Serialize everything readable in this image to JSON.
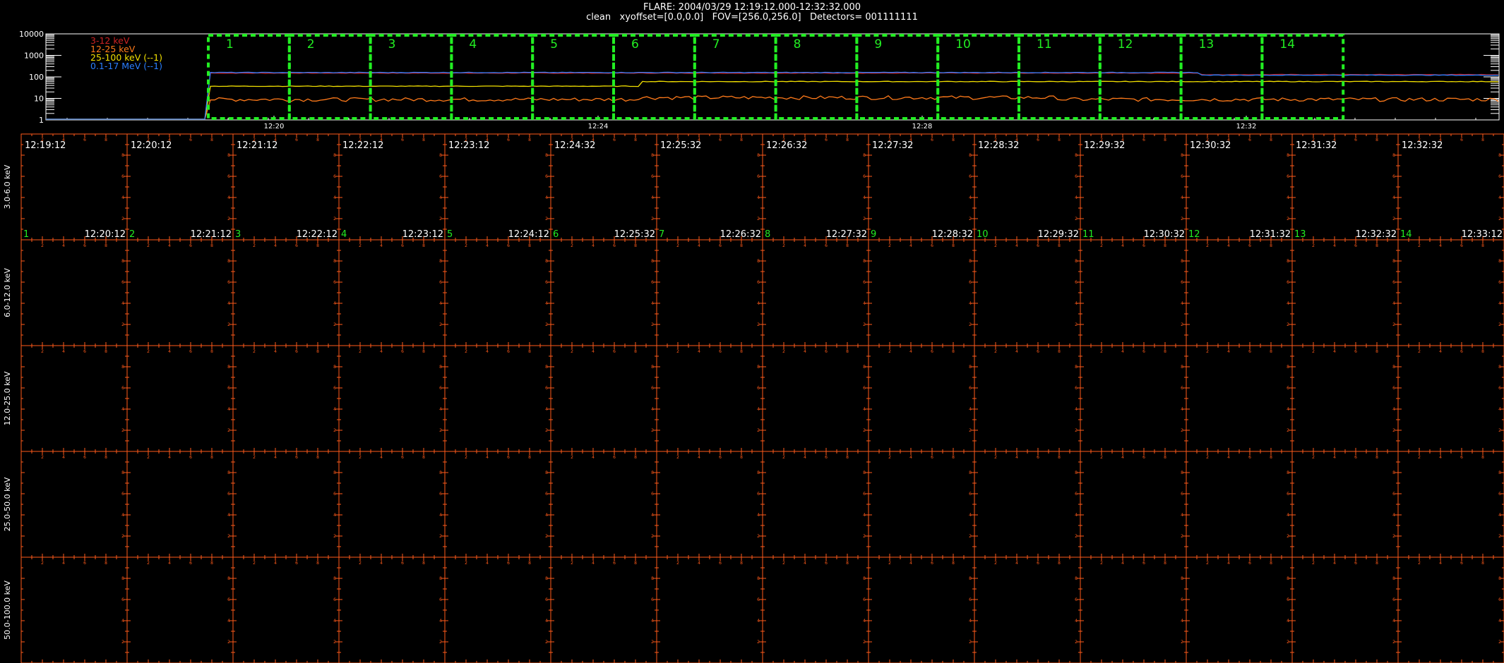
{
  "header": {
    "line1": "FLARE: 2004/03/29 12:19:12.000-12:32:32.000",
    "line2": "clean   xyoffset=[0.0,0.0]   FOV=[256.0,256.0]   Detectors= 001111111"
  },
  "chart_data": [
    {
      "type": "line",
      "scale": "log",
      "y_ticks": [
        "10000",
        "1000",
        "100",
        "10",
        "1"
      ],
      "ylim": [
        1,
        10000
      ],
      "x_ticks": [
        "12:20",
        "12:24",
        "12:28",
        "12:32"
      ],
      "legend_placement": "top-left",
      "series": [
        {
          "name": "3-12 keV",
          "color": "#cc2222",
          "level": 150
        },
        {
          "name": "12-25 keV",
          "color": "#ff7a1a",
          "level_min": 6,
          "level_max": 12
        },
        {
          "name": "25-100 keV (--1)",
          "color": "#f2e000",
          "level": 45
        },
        {
          "name": "0.1-17 MeV (--1)",
          "color": "#2a7fff",
          "level": 160
        }
      ],
      "intervals": [
        "1",
        "2",
        "3",
        "4",
        "5",
        "6",
        "7",
        "8",
        "9",
        "10",
        "11",
        "12",
        "13",
        "14"
      ],
      "interval_color": "#22ee22"
    },
    {
      "type": "table",
      "rows": [
        "3.0-6.0 keV",
        "6.0-12.0 keV",
        "12.0-25.0 keV",
        "25.0-50.0 keV",
        "50.0-100.0 keV"
      ],
      "start_times": [
        "12:19:12",
        "12:20:12",
        "12:21:12",
        "12:22:12",
        "12:23:12",
        "12:24:32",
        "12:25:32",
        "12:26:32",
        "12:27:32",
        "12:28:32",
        "12:29:32",
        "12:30:32",
        "12:31:32",
        "12:32:32"
      ],
      "end_times": [
        "12:20:12",
        "12:21:12",
        "12:22:12",
        "12:23:12",
        "12:24:12",
        "12:25:32",
        "12:26:32",
        "12:27:32",
        "12:28:32",
        "12:29:32",
        "12:30:32",
        "12:31:32",
        "12:32:32",
        "12:33:12"
      ],
      "interval_numbers": [
        "1",
        "2",
        "3",
        "4",
        "5",
        "6",
        "7",
        "8",
        "9",
        "10",
        "11",
        "12",
        "13",
        "14"
      ],
      "axis_color": "#ff5a1a"
    }
  ]
}
